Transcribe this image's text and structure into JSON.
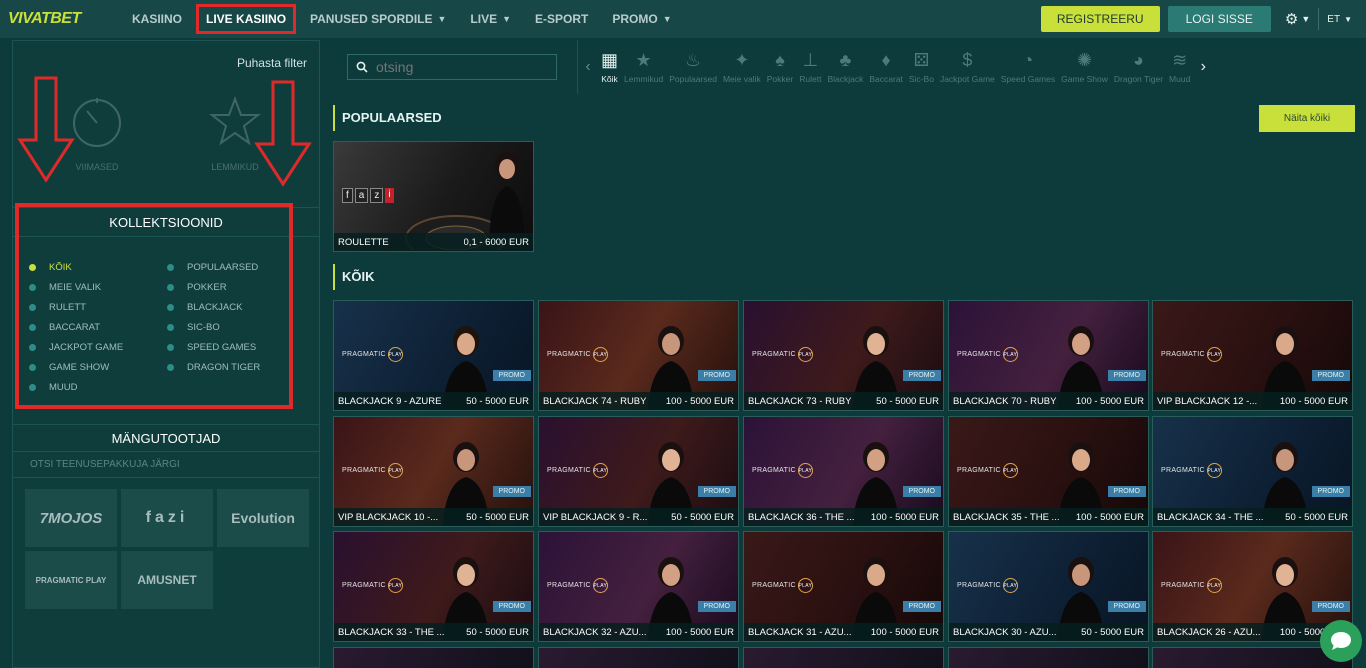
{
  "brand": {
    "logo": "VIVATBET",
    "accent": "#c9e03a",
    "highlight": "#e02a2a"
  },
  "nav": {
    "items": [
      {
        "label": "KASIINO",
        "chevron": false,
        "active": false
      },
      {
        "label": "LIVE KASIINO",
        "chevron": false,
        "active": true
      },
      {
        "label": "PANUSED SPORDILE",
        "chevron": true,
        "active": false
      },
      {
        "label": "LIVE",
        "chevron": true,
        "active": false
      },
      {
        "label": "E-SPORT",
        "chevron": false,
        "active": false
      },
      {
        "label": "PROMO",
        "chevron": true,
        "active": false
      }
    ],
    "register": "REGISTREERU",
    "login": "LOGI SISSE",
    "language": "ET"
  },
  "sidebar": {
    "clear_filter": "Puhasta filter",
    "recent": "VIIMASED",
    "favorites": "LEMMIKUD",
    "collections_title": "KOLLEKTSIOONID",
    "collections": [
      {
        "label": "KÕIK",
        "selected": true
      },
      {
        "label": "POPULAARSED",
        "selected": false
      },
      {
        "label": "MEIE VALIK",
        "selected": false
      },
      {
        "label": "POKKER",
        "selected": false
      },
      {
        "label": "RULETT",
        "selected": false
      },
      {
        "label": "BLACKJACK",
        "selected": false
      },
      {
        "label": "BACCARAT",
        "selected": false
      },
      {
        "label": "SIC-BO",
        "selected": false
      },
      {
        "label": "JACKPOT GAME",
        "selected": false
      },
      {
        "label": "SPEED GAMES",
        "selected": false
      },
      {
        "label": "GAME SHOW",
        "selected": false
      },
      {
        "label": "DRAGON TIGER",
        "selected": false
      },
      {
        "label": "MUUD",
        "selected": false
      }
    ],
    "providers_title": "MÄNGUTOOTJAD",
    "providers_search": "OTSI TEENUSEPAKKUJA JÄRGI",
    "providers": [
      "7MOJOS",
      "fazi",
      "Evolution",
      "PRAGMATIC PLAY",
      "AMUSNET"
    ]
  },
  "search": {
    "placeholder": "otsing"
  },
  "categories": [
    {
      "label": "Kõik",
      "icon": "grid-icon",
      "active": true
    },
    {
      "label": "Lemmikud",
      "icon": "star-icon",
      "active": false
    },
    {
      "label": "Populaarsed",
      "icon": "flame-icon",
      "active": false
    },
    {
      "label": "Meie valik",
      "icon": "stars-icon",
      "active": false
    },
    {
      "label": "Pokker",
      "icon": "cards-icon",
      "active": false
    },
    {
      "label": "Rulett",
      "icon": "roulette-icon",
      "active": false
    },
    {
      "label": "Blackjack",
      "icon": "blackjack-icon",
      "active": false
    },
    {
      "label": "Baccarat",
      "icon": "baccarat-icon",
      "active": false
    },
    {
      "label": "Sic-Bo",
      "icon": "dice-icon",
      "active": false
    },
    {
      "label": "Jackpot Game",
      "icon": "moneybag-icon",
      "active": false
    },
    {
      "label": "Speed Games",
      "icon": "speedometer-icon",
      "active": false
    },
    {
      "label": "Game Show",
      "icon": "wheel-icon",
      "active": false
    },
    {
      "label": "Dragon Tiger",
      "icon": "dragon-icon",
      "active": false
    },
    {
      "label": "Muud",
      "icon": "layers-icon",
      "active": false
    }
  ],
  "popular": {
    "title": "POPULAARSED",
    "more": "Näita kõiki",
    "tiles": [
      {
        "name": "ROULETTE",
        "limit": "0,1 - 6000 EUR",
        "provider": "fazi"
      }
    ]
  },
  "all": {
    "title": "KÕIK",
    "promo_label": "PROMO",
    "provider_label": "PRAGMATIC",
    "tiles": [
      {
        "name": "BLACKJACK 9 - AZURE",
        "limit": "50 - 5000 EUR"
      },
      {
        "name": "BLACKJACK 74 - RUBY",
        "limit": "100 - 5000 EUR"
      },
      {
        "name": "BLACKJACK 73 - RUBY",
        "limit": "50 - 5000 EUR"
      },
      {
        "name": "BLACKJACK 70 - RUBY",
        "limit": "100 - 5000 EUR"
      },
      {
        "name": "VIP BLACKJACK 12 -...",
        "limit": "100 - 5000 EUR"
      },
      {
        "name": "VIP BLACKJACK 10 -...",
        "limit": "50 - 5000 EUR"
      },
      {
        "name": "VIP BLACKJACK 9 - R...",
        "limit": "50 - 5000 EUR"
      },
      {
        "name": "BLACKJACK 36 - THE ...",
        "limit": "100 - 5000 EUR"
      },
      {
        "name": "BLACKJACK 35 - THE ...",
        "limit": "100 - 5000 EUR"
      },
      {
        "name": "BLACKJACK 34 - THE ...",
        "limit": "50 - 5000 EUR"
      },
      {
        "name": "BLACKJACK 33 - THE ...",
        "limit": "50 - 5000 EUR"
      },
      {
        "name": "BLACKJACK 32 - AZU...",
        "limit": "100 - 5000 EUR"
      },
      {
        "name": "BLACKJACK 31 - AZU...",
        "limit": "100 - 5000 EUR"
      },
      {
        "name": "BLACKJACK 30 - AZU...",
        "limit": "50 - 5000 EUR"
      },
      {
        "name": "BLACKJACK 26 - AZU...",
        "limit": "100 - 5000 EUR"
      }
    ]
  }
}
